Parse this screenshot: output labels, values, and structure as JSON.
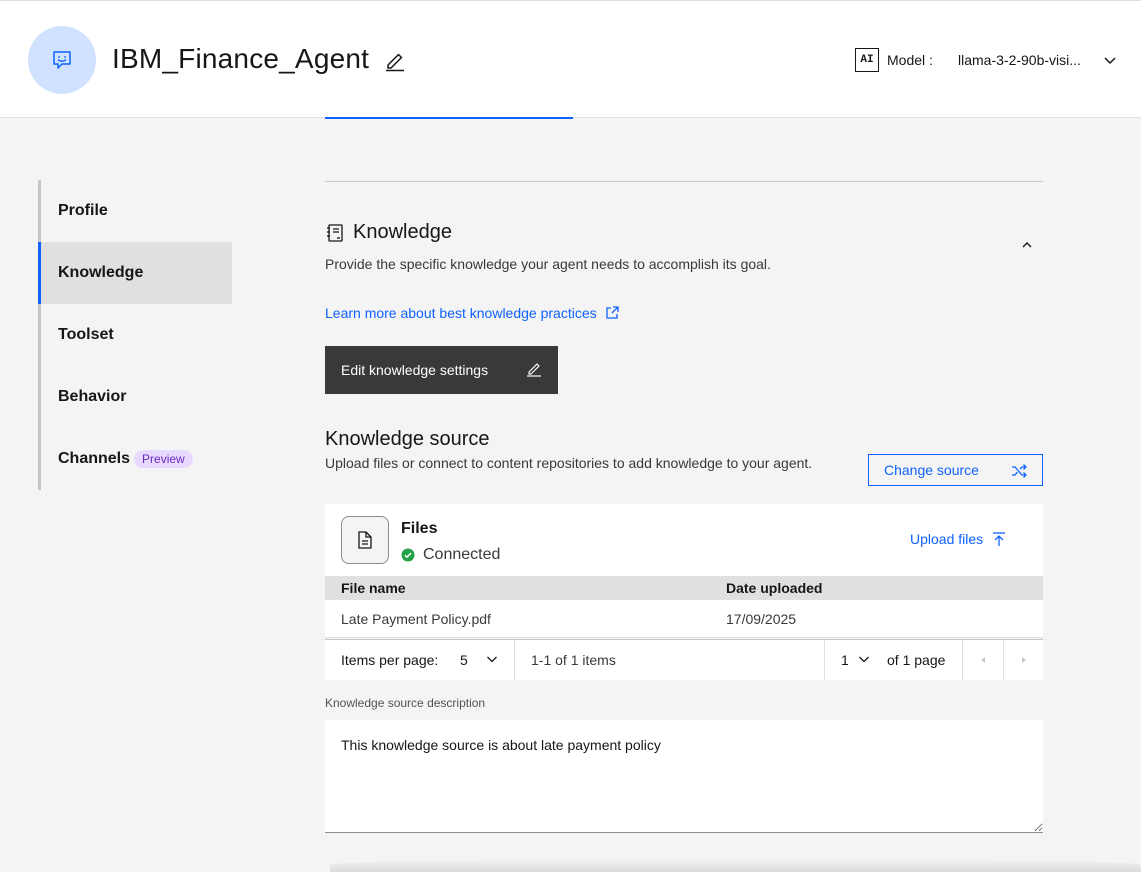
{
  "header": {
    "agent_name": "IBM_Finance_Agent",
    "ai_badge": "AI",
    "model_label": "Model :",
    "model_value": "llama-3-2-90b-visi..."
  },
  "sidenav": {
    "items": [
      {
        "label": "Profile"
      },
      {
        "label": "Knowledge"
      },
      {
        "label": "Toolset"
      },
      {
        "label": "Behavior"
      },
      {
        "label": "Channels"
      }
    ],
    "preview_tag": "Preview"
  },
  "knowledge": {
    "title": "Knowledge",
    "description": "Provide the specific knowledge your agent needs to accomplish its goal.",
    "learn_more": "Learn more about best knowledge practices",
    "edit_settings": "Edit knowledge settings"
  },
  "source": {
    "title": "Knowledge source",
    "description": "Upload files or connect to content repositories to add knowledge to your agent.",
    "change_button": "Change source",
    "card_title": "Files",
    "status": "Connected",
    "upload_button": "Upload files"
  },
  "table": {
    "headers": [
      "File name",
      "Date uploaded"
    ],
    "rows": [
      {
        "file": "Late Payment Policy.pdf",
        "date": "17/09/2025"
      }
    ]
  },
  "pagination": {
    "items_per_page_label": "Items per page:",
    "items_per_page": "5",
    "range": "1-1 of 1 items",
    "page": "1",
    "of_pages": "of 1 page"
  },
  "description_field": {
    "label": "Knowledge source description",
    "value": "This knowledge source is about late payment policy"
  },
  "colors": {
    "accent": "#0f62fe",
    "success": "#24a148",
    "avatar_bg": "#d0e2ff",
    "preview_tag_bg": "#e8daff",
    "preview_tag_text": "#6929c4",
    "dark_button": "#393939"
  },
  "icons": {
    "avatar": "chat-bot-icon",
    "edit": "pencil-icon",
    "model_dropdown": "chevron-down-icon",
    "knowledge": "notebook-icon",
    "collapse": "chevron-up-icon",
    "external_link": "launch-icon",
    "change_source": "shuffle-icon",
    "file": "document-icon",
    "status": "checkmark-filled-icon",
    "upload": "upload-icon",
    "prev": "caret-left-icon",
    "next": "caret-right-icon"
  }
}
